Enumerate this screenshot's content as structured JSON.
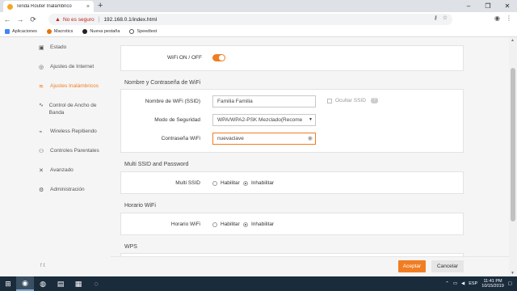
{
  "browser": {
    "tab_title": "Tenda Router Inalámbrico",
    "tab_close": "×",
    "new_tab": "+",
    "window_controls": [
      "–",
      "❐",
      "✕"
    ],
    "not_secure": "No es seguro",
    "url": "192.168.0.1/index.html",
    "nav": {
      "back": "←",
      "forward": "→",
      "reload": "⟳"
    },
    "bookmarks": [
      {
        "label": "Aplicaciones",
        "icon": "apps-grid-icon",
        "color": "#4285f4"
      },
      {
        "label": "Macrotics",
        "icon": "macrotics-icon",
        "color": "#e8710a"
      },
      {
        "label": "Nueva pestaña",
        "icon": "new-tab-icon",
        "color": "#222222"
      },
      {
        "label": "Speedtest",
        "icon": "speedtest-icon",
        "color": "#555555"
      }
    ]
  },
  "sidebar": {
    "items": [
      {
        "label": "Estado",
        "icon": "status-icon",
        "glyph": "▣",
        "active": false
      },
      {
        "label": "Ajustes de Internet",
        "icon": "globe-icon",
        "glyph": "◎",
        "active": false
      },
      {
        "label": "Ajustes Inalámbricos",
        "icon": "wifi-icon",
        "glyph": "≋",
        "active": true
      },
      {
        "label": "Control de Ancho de Banda",
        "icon": "bandwidth-icon",
        "glyph": "∿",
        "active": false
      },
      {
        "label": "Wireless Repitiendo",
        "icon": "repeater-icon",
        "glyph": "⌁",
        "active": false
      },
      {
        "label": "Controles Parentales",
        "icon": "parental-icon",
        "glyph": "⚇",
        "active": false
      },
      {
        "label": "Avanzado",
        "icon": "tools-icon",
        "glyph": "✕",
        "active": false
      },
      {
        "label": "Administración",
        "icon": "gear-icon",
        "glyph": "⚙",
        "active": false
      }
    ],
    "social": "f  𝕥"
  },
  "main": {
    "wifi_toggle_label": "WiFi ON / OFF",
    "section_ssid_title": "Nombre y Contraseña de WiFi",
    "ssid_label": "Nombre de WiFi (SSID)",
    "ssid_value": "Familia Familia",
    "hide_ssid_label": "Ocultar SSID",
    "help_glyph": "(?)",
    "security_label": "Modo de Seguridad",
    "security_value": "WPA/WPA2-PSK Mezclado(Recome",
    "password_label": "Contraseña WiFi",
    "password_value": "nuevaclave",
    "section_multi_title": "Multi SSID and Password",
    "multi_ssid_label": "Multi SSID",
    "enable_label": "Habilitar",
    "disable_label": "Inhabilitar",
    "section_schedule_title": "Horario WiFi",
    "schedule_label": "Horario WiFi",
    "section_wps_title": "WPS",
    "accept_button": "Aceptar",
    "cancel_button": "Cancelar"
  },
  "accent_color": "#f07d22",
  "taskbar": {
    "language": "ESP",
    "time": "11:41 PM",
    "date": "10/15/2019"
  }
}
